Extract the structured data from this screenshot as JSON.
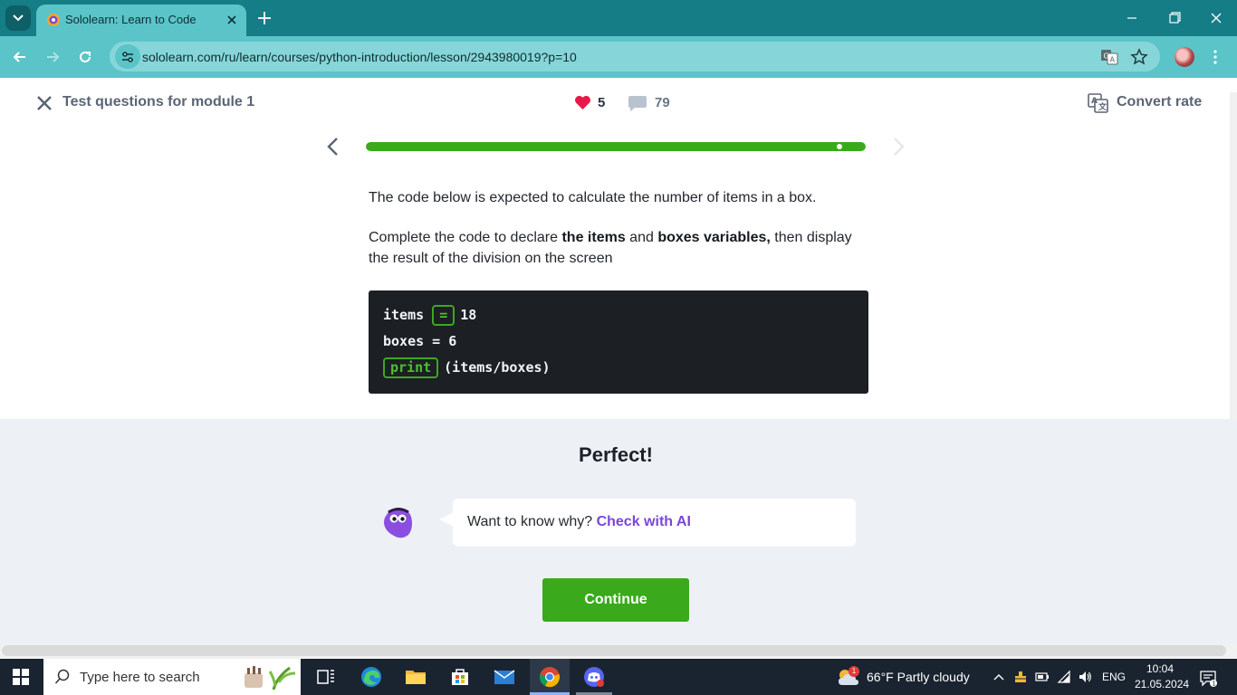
{
  "browser": {
    "tab_title": "Sololearn: Learn to Code",
    "url": "sololearn.com/ru/learn/courses/python-introduction/lesson/2943980019?p=10"
  },
  "lesson": {
    "title": "Test questions for module 1",
    "hearts": "5",
    "comments": "79",
    "convert_label": "Convert rate",
    "progress_fraction": 1.0
  },
  "question": {
    "line1": "The code below is expected to calculate the number of items in a box.",
    "line2_a": "Complete the code to declare ",
    "line2_b": "the items",
    "line2_c": " and ",
    "line2_d": "boxes variables,",
    "line2_e": " then display the result of the division on the screen"
  },
  "code": {
    "l1_var": "items ",
    "l1_blank": "=",
    "l1_val": "18",
    "l2": "boxes = 6",
    "l3_blank": "print",
    "l3_rest": "(items/boxes)"
  },
  "result": {
    "title": "Perfect!",
    "bubble_prefix": "Want to know why? ",
    "bubble_link": "Check with AI",
    "continue_label": "Continue"
  },
  "taskbar": {
    "search_placeholder": "Type here to search",
    "weather": "66°F  Partly cloudy",
    "weather_badge": "1",
    "lang": "ENG",
    "time": "10:04",
    "date": "21.05.2024"
  },
  "colors": {
    "accent_green": "#3aaa1c",
    "ai_purple": "#7a46d6",
    "heart_red": "#e8194a",
    "chrome_teal": "#5bc4c8"
  },
  "icons": [
    "tab-search-icon",
    "sololearn-favicon",
    "close-icon",
    "plus-icon",
    "minimize-icon",
    "restore-icon",
    "back-icon",
    "forward-icon",
    "reload-icon",
    "site-info-icon",
    "translate-icon",
    "star-icon",
    "kebab-menu-icon",
    "heart-icon",
    "comment-icon",
    "chevron-left-icon",
    "chevron-right-icon",
    "mascot-icon",
    "windows-icon",
    "search-icon",
    "task-view-icon",
    "edge-icon",
    "file-explorer-icon",
    "store-icon",
    "mail-icon",
    "chrome-icon",
    "discord-icon",
    "weather-icon",
    "chevron-up-icon",
    "network-icon",
    "battery-icon",
    "wifi-icon",
    "volume-icon",
    "notification-icon"
  ]
}
